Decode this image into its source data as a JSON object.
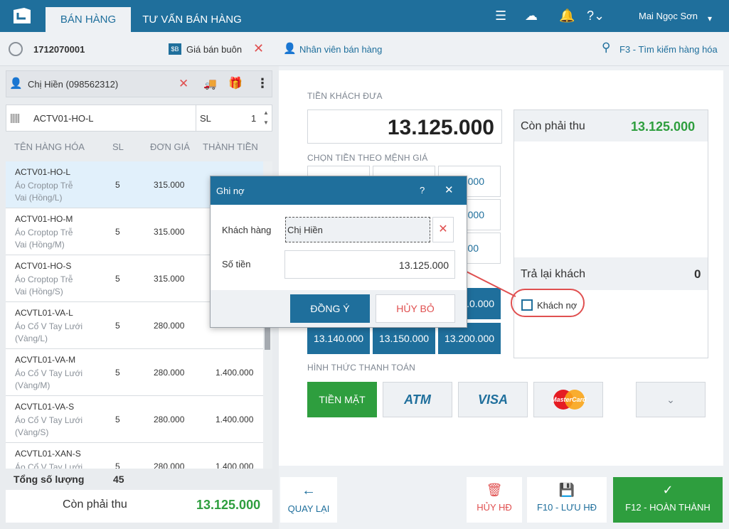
{
  "topbar": {
    "tabs": [
      {
        "label": "BÁN HÀNG"
      },
      {
        "label": "TƯ VẤN BÁN HÀNG"
      }
    ],
    "user": "Mai Ngọc Sơn"
  },
  "subbar": {
    "invoice_no": "1712070001",
    "price_list": "Giá bán buôn",
    "staff": "Nhân viên bán hàng",
    "search": "F3 - Tìm kiếm hàng hóa"
  },
  "customer": {
    "name": "Chị Hiền (098562312)"
  },
  "item_search": {
    "value": "ACTV01-HO-L",
    "qty_label": "SL",
    "qty": "1"
  },
  "table": {
    "headers": [
      "TÊN HÀNG HÓA",
      "SL",
      "ĐƠN GIÁ",
      "THÀNH TIỀN"
    ],
    "rows": [
      {
        "code": "ACTV01-HO-L",
        "name": "Áo Croptop Trễ Vai (Hồng/L)",
        "qty": "5",
        "price": "315.000",
        "total": ""
      },
      {
        "code": "ACTV01-HO-M",
        "name": "Áo Croptop Trễ Vai (Hồng/M)",
        "qty": "5",
        "price": "315.000",
        "total": ""
      },
      {
        "code": "ACTV01-HO-S",
        "name": "Áo Croptop Trễ Vai (Hồng/S)",
        "qty": "5",
        "price": "315.000",
        "total": ""
      },
      {
        "code": "ACVTL01-VA-L",
        "name": "Áo Cổ V Tay Lưới (Vàng/L)",
        "qty": "5",
        "price": "280.000",
        "total": ""
      },
      {
        "code": "ACVTL01-VA-M",
        "name": "Áo Cổ V Tay Lưới (Vàng/M)",
        "qty": "5",
        "price": "280.000",
        "total": "1.400.000"
      },
      {
        "code": "ACVTL01-VA-S",
        "name": "Áo Cổ V Tay Lưới (Vàng/S)",
        "qty": "5",
        "price": "280.000",
        "total": "1.400.000"
      },
      {
        "code": "ACVTL01-XAN-S",
        "name": "Áo Cổ V Tay Lưới",
        "qty": "5",
        "price": "280.000",
        "total": "1.400.000"
      }
    ]
  },
  "totals": {
    "qty_label": "Tổng số lượng",
    "qty": "45",
    "due_label": "Còn phải thu",
    "due": "13.125.000"
  },
  "payment": {
    "cash_label": "TIỀN KHÁCH ĐƯA",
    "cash_value": "13.125.000",
    "denom_label": "CHỌN TIỀN THEO MỆNH GIÁ",
    "denoms_partial": [
      "000",
      "000",
      "00",
      ".0.000"
    ],
    "denoms": [
      "13.140.000",
      "13.150.000",
      "13.200.000"
    ],
    "due_label": "Còn phải thu",
    "due": "13.125.000",
    "return_label": "Trả lại khách",
    "return": "0",
    "debt_label": "Khách nợ",
    "method_label": "HÌNH THỨC THANH TOÁN",
    "cash_btn": "TIỀN MẶT",
    "atm": "ATM",
    "visa": "VISA",
    "mastercard": "MasterCard"
  },
  "bottom": {
    "back": "QUAY LẠI",
    "cancel": "HỦY HĐ",
    "save": "F10 - LƯU HĐ",
    "done": "F12 - HOÀN THÀNH"
  },
  "modal": {
    "title": "Ghi nợ",
    "help": "?",
    "customer_label": "Khách hàng",
    "customer": "Chị Hiền",
    "amount_label": "Số tiền",
    "amount": "13.125.000",
    "ok": "ĐỒNG Ý",
    "cancel": "HỦY BỎ"
  },
  "colors": {
    "primary": "#1f6f9c",
    "green": "#2e9e3e",
    "red": "#e05050"
  }
}
